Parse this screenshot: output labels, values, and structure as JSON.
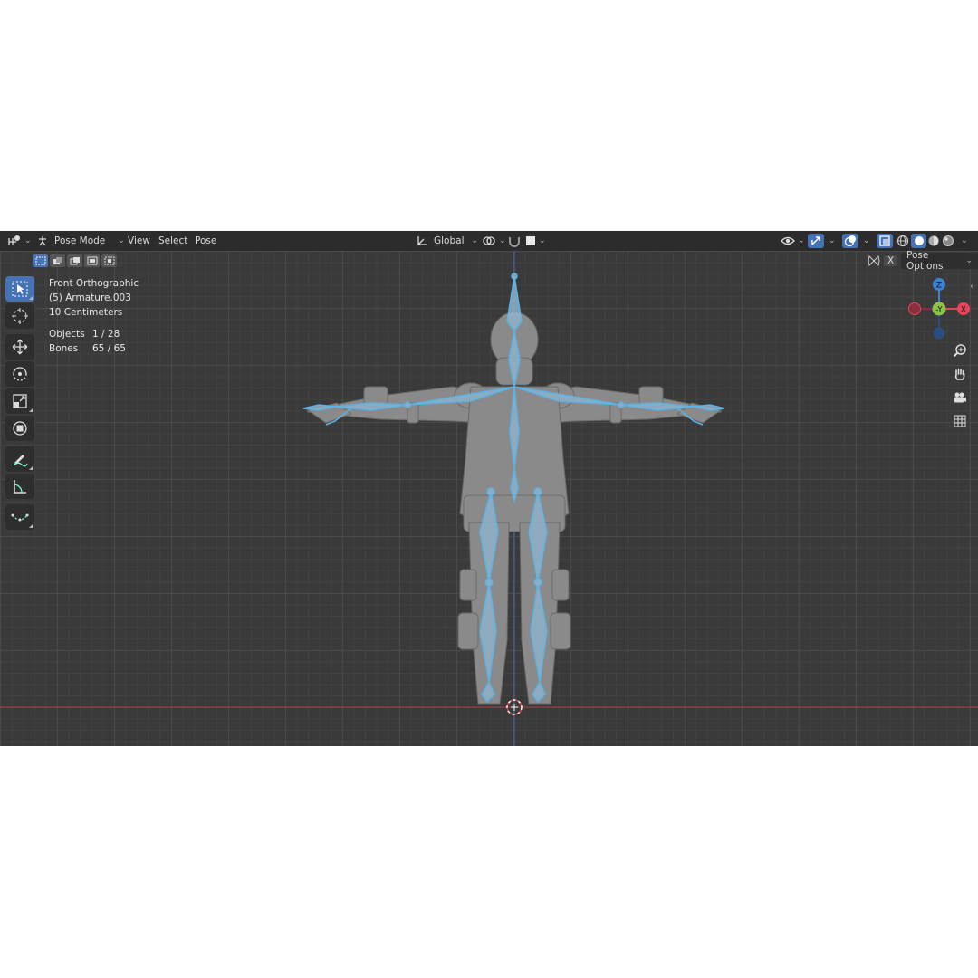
{
  "header": {
    "editor_type_icon": "3d-viewport-icon",
    "mode_label": "Pose Mode",
    "menus": [
      "View",
      "Select",
      "Pose"
    ],
    "transform_orientation": "Global",
    "pivot_icon": "pivot-icon",
    "snap_icon": "magnet-icon",
    "proportional_icon": "proportional-edit-icon"
  },
  "pose_options": {
    "label": "Pose Options",
    "mirror_label": "X"
  },
  "overlay": {
    "view_name": "Front Orthographic",
    "object_name": "(5) Armature.003",
    "scale": "10 Centimeters",
    "objects_label": "Objects",
    "objects_value": "1 / 28",
    "bones_label": "Bones",
    "bones_value": "65 / 65"
  },
  "gizmo": {
    "z_label": "Z",
    "y_label": "-Y",
    "x_label": "X",
    "colors": {
      "x": "#e8445a",
      "y": "#8bc34a",
      "z": "#3b82d4"
    }
  },
  "tools": [
    "select-box-icon",
    "cursor-icon",
    "move-icon",
    "rotate-icon",
    "scale-icon",
    "transform-icon",
    "annotate-icon",
    "measure-icon",
    "relax-pose-icon"
  ],
  "nav_buttons": [
    "zoom-icon",
    "hand-pan-icon",
    "camera-icon",
    "grid-icon"
  ],
  "colors": {
    "accent": "#4772b3",
    "bone": "#8fb8d8",
    "bone_outline": "#5cb3e6",
    "model": "#8a8a8a"
  }
}
